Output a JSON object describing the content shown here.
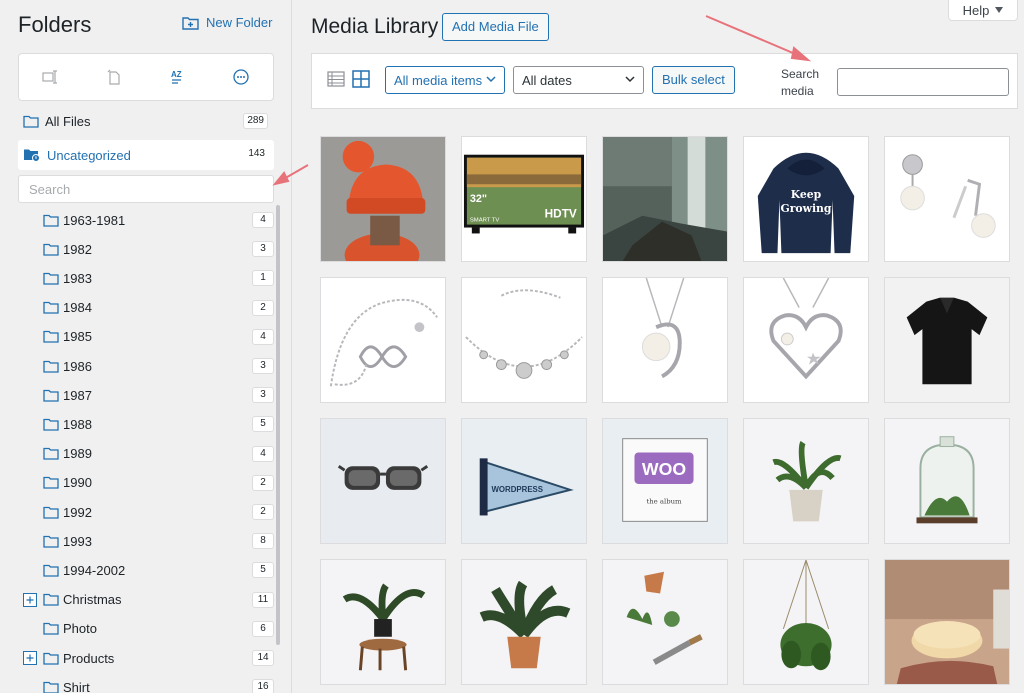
{
  "sidebar": {
    "title": "Folders",
    "new_folder_label": "New Folder",
    "toolbar_icons": [
      "rename-icon",
      "delete-icon",
      "sort-az-icon",
      "more-icon"
    ],
    "sort_label": "AZ",
    "all_files": {
      "label": "All Files",
      "count": "289"
    },
    "uncategorized": {
      "label": "Uncategorized",
      "count": "143"
    },
    "search_placeholder": "Search",
    "folders": [
      {
        "label": "1963-1981",
        "count": "4",
        "expandable": false
      },
      {
        "label": "1982",
        "count": "3",
        "expandable": false
      },
      {
        "label": "1983",
        "count": "1",
        "expandable": false
      },
      {
        "label": "1984",
        "count": "2",
        "expandable": false
      },
      {
        "label": "1985",
        "count": "4",
        "expandable": false
      },
      {
        "label": "1986",
        "count": "3",
        "expandable": false
      },
      {
        "label": "1987",
        "count": "3",
        "expandable": false
      },
      {
        "label": "1988",
        "count": "5",
        "expandable": false
      },
      {
        "label": "1989",
        "count": "4",
        "expandable": false
      },
      {
        "label": "1990",
        "count": "2",
        "expandable": false
      },
      {
        "label": "1992",
        "count": "2",
        "expandable": false
      },
      {
        "label": "1993",
        "count": "8",
        "expandable": false
      },
      {
        "label": "1994-2002",
        "count": "5",
        "expandable": false
      },
      {
        "label": "Christmas",
        "count": "11",
        "expandable": true
      },
      {
        "label": "Photo",
        "count": "6",
        "expandable": false
      },
      {
        "label": "Products",
        "count": "14",
        "expandable": true
      },
      {
        "label": "Shirt",
        "count": "16",
        "expandable": false
      }
    ]
  },
  "header": {
    "title": "Media Library",
    "add_media_label": "Add Media File",
    "help_label": "Help"
  },
  "filters": {
    "type_value": "All media items",
    "date_value": "All dates",
    "bulk_select_label": "Bulk select",
    "search_label": "Search media",
    "search_value": ""
  },
  "media": [
    {
      "name": "orange-beanie",
      "bg": "#9a9a96"
    },
    {
      "name": "smart-tv",
      "bg": "#ffffff",
      "text_big": "32\"",
      "text_hdtv": "HDTV",
      "text_small": "SMART TV"
    },
    {
      "name": "waterfall",
      "bg": "#4e5a55"
    },
    {
      "name": "hoodie",
      "bg": "#ffffff",
      "text_line1": "Keep",
      "text_line2": "Growing"
    },
    {
      "name": "pearl-earrings",
      "bg": "#ffffff"
    },
    {
      "name": "infinity-bracelet",
      "bg": "#ffffff"
    },
    {
      "name": "flower-bracelet",
      "bg": "#ffffff"
    },
    {
      "name": "pearl-pendant",
      "bg": "#ffffff"
    },
    {
      "name": "heart-pendant",
      "bg": "#ffffff"
    },
    {
      "name": "black-polo",
      "bg": "#f2f2f2"
    },
    {
      "name": "sunglasses",
      "bg": "#e8ecf0"
    },
    {
      "name": "wordpress-pennant",
      "bg": "#e8eef2",
      "text": "WORDPRESS"
    },
    {
      "name": "woo-album",
      "bg": "#e8eef2",
      "text": "WOO",
      "sub": "the album"
    },
    {
      "name": "potted-plant",
      "bg": "#f4f4f6"
    },
    {
      "name": "terrarium",
      "bg": "#f4f4f6"
    },
    {
      "name": "plant-on-stool",
      "bg": "#f4f4f6"
    },
    {
      "name": "calathea-plant",
      "bg": "#f4f4f6"
    },
    {
      "name": "gardening-tools",
      "bg": "#f4f4f6"
    },
    {
      "name": "hanging-plant",
      "bg": "#f4f4f6"
    },
    {
      "name": "soap-bar",
      "bg": "#c8a48a"
    }
  ],
  "colors": {
    "accent": "#2271b1",
    "annotation": "#e8727a"
  }
}
